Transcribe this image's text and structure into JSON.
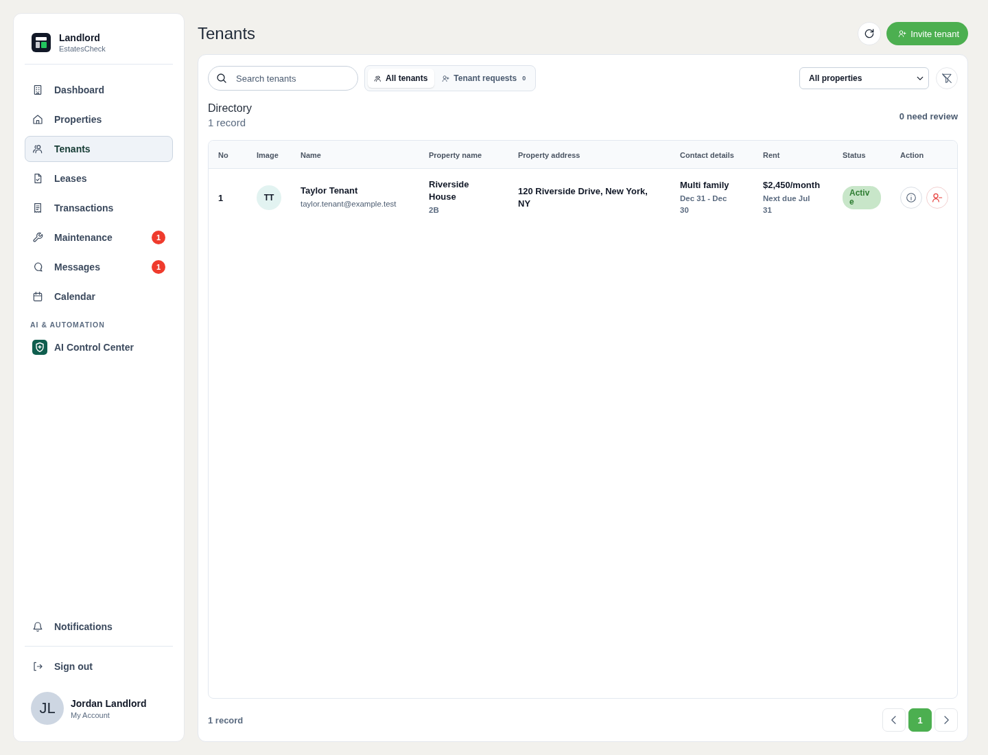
{
  "sidebar": {
    "brand": {
      "title": "Landlord",
      "subtitle": "EstatesCheck"
    },
    "nav": [
      {
        "label": "Dashboard",
        "selected": false
      },
      {
        "label": "Properties",
        "selected": false
      },
      {
        "label": "Tenants",
        "selected": true
      },
      {
        "label": "Leases",
        "selected": false
      },
      {
        "label": "Transactions",
        "selected": false
      },
      {
        "label": "Maintenance",
        "selected": false,
        "badge": "1"
      },
      {
        "label": "Messages",
        "selected": false,
        "badge": "1"
      },
      {
        "label": "Calendar",
        "selected": false
      }
    ],
    "section_label": "AI & AUTOMATION",
    "ai_items": [
      {
        "label": "AI Control Center",
        "selected": false
      }
    ],
    "footer_items": [
      {
        "label": "Notifications"
      },
      {
        "label": "Sign out"
      }
    ],
    "account": {
      "initials": "JL",
      "name": "Jordan Landlord",
      "subtitle": "My Account"
    }
  },
  "header": {
    "title": "Tenants",
    "invite_button": "Invite tenant"
  },
  "toolbar": {
    "search": {
      "placeholder": "Search tenants"
    },
    "tabs": [
      {
        "label": "All tenants",
        "selected": true
      },
      {
        "label": "Tenant requests",
        "count": "0",
        "selected": false
      }
    ],
    "property_filter": {
      "value": "All properties"
    }
  },
  "directory": {
    "title": "Directory",
    "record_count": "1 record",
    "review_count": "0 need review"
  },
  "table": {
    "columns": [
      "No",
      "Image",
      "Name",
      "Property name",
      "Property address",
      "Contact details",
      "Rent",
      "Status",
      "Action"
    ],
    "rows": [
      {
        "no": "1",
        "initials": "TT",
        "name": "Taylor Tenant",
        "email": "taylor.tenant@example.test",
        "property_name": "Riverside House",
        "unit": "2B",
        "address": "120 Riverside Drive, New York, NY",
        "property_type": "Multi family",
        "lease_dates": "Dec 31 - Dec 30",
        "rent": "$2,450/month",
        "next_due": "Next due Jul 31",
        "status": "Active"
      }
    ]
  },
  "footer": {
    "record_count": "1 record",
    "pages": [
      {
        "label": "1",
        "selected": true
      }
    ]
  }
}
